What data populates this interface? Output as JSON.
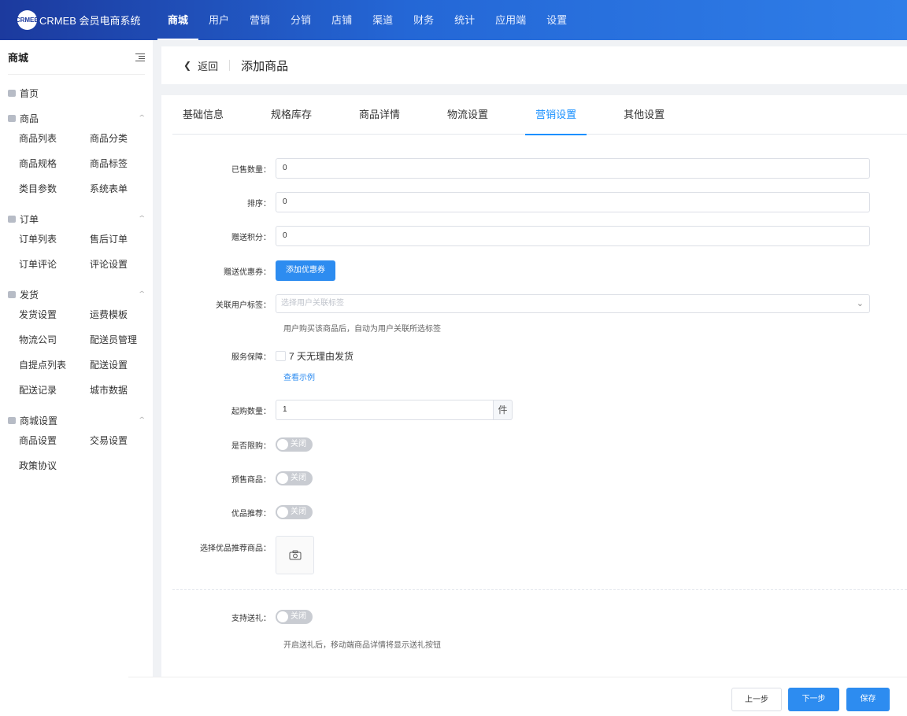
{
  "brand": {
    "logo_mark": "CRMEB",
    "name": "CRMEB 会员电商系统"
  },
  "topnav": [
    {
      "label": "商城",
      "active": true
    },
    {
      "label": "用户"
    },
    {
      "label": "营销"
    },
    {
      "label": "分销"
    },
    {
      "label": "店铺"
    },
    {
      "label": "渠道"
    },
    {
      "label": "财务"
    },
    {
      "label": "统计"
    },
    {
      "label": "应用端"
    },
    {
      "label": "设置"
    }
  ],
  "sidebar": {
    "title": "商城",
    "home": "首页",
    "groups": [
      {
        "label": "商品",
        "icon": "shop-icon",
        "items": [
          "商品列表",
          "商品分类",
          "商品规格",
          "商品标签",
          "类目参数",
          "系统表单"
        ]
      },
      {
        "label": "订单",
        "icon": "cart-icon",
        "items": [
          "订单列表",
          "售后订单",
          "订单评论",
          "评论设置"
        ]
      },
      {
        "label": "发货",
        "icon": "lock-icon",
        "items": [
          "发货设置",
          "运费模板",
          "物流公司",
          "配送员管理",
          "自提点列表",
          "配送设置",
          "配送记录",
          "城市数据"
        ]
      },
      {
        "label": "商城设置",
        "icon": "store-settings-icon",
        "items": [
          "商品设置",
          "交易设置",
          "政策协议"
        ]
      }
    ]
  },
  "header": {
    "back": "返回",
    "title": "添加商品"
  },
  "tabs": [
    {
      "label": "基础信息"
    },
    {
      "label": "规格库存"
    },
    {
      "label": "商品详情"
    },
    {
      "label": "物流设置"
    },
    {
      "label": "营销设置",
      "active": true
    },
    {
      "label": "其他设置"
    }
  ],
  "form": {
    "sold": {
      "label": "已售数量：",
      "value": "0"
    },
    "sort": {
      "label": "排序：",
      "value": "0"
    },
    "points": {
      "label": "赠送积分：",
      "value": "0"
    },
    "coupon": {
      "label": "赠送优惠券：",
      "button": "添加优惠券"
    },
    "user_tag": {
      "label": "关联用户标签：",
      "placeholder": "选择用户关联标签",
      "hint": "用户购买该商品后，自动为用户关联所选标签"
    },
    "service": {
      "label": "服务保障：",
      "option": "7 天无理由发货",
      "example": "查看示例"
    },
    "min_buy": {
      "label": "起购数量：",
      "value": "1",
      "unit": "件"
    },
    "limit": {
      "label": "是否限购：",
      "state": "关闭"
    },
    "presale": {
      "label": "预售商品：",
      "state": "关闭"
    },
    "recommend": {
      "label": "优品推荐：",
      "state": "关闭"
    },
    "recommend_pick": {
      "label": "选择优品推荐商品："
    },
    "gift": {
      "label": "支持送礼：",
      "state": "关闭",
      "hint": "开启送礼后，移动端商品详情将显示送礼按钮"
    }
  },
  "footer": {
    "prev": "上一步",
    "next": "下一步",
    "save": "保存"
  },
  "colors": {
    "primary": "#2d8cf0",
    "topbar_start": "#1c3a9e",
    "topbar_end": "#2f7ee8"
  }
}
